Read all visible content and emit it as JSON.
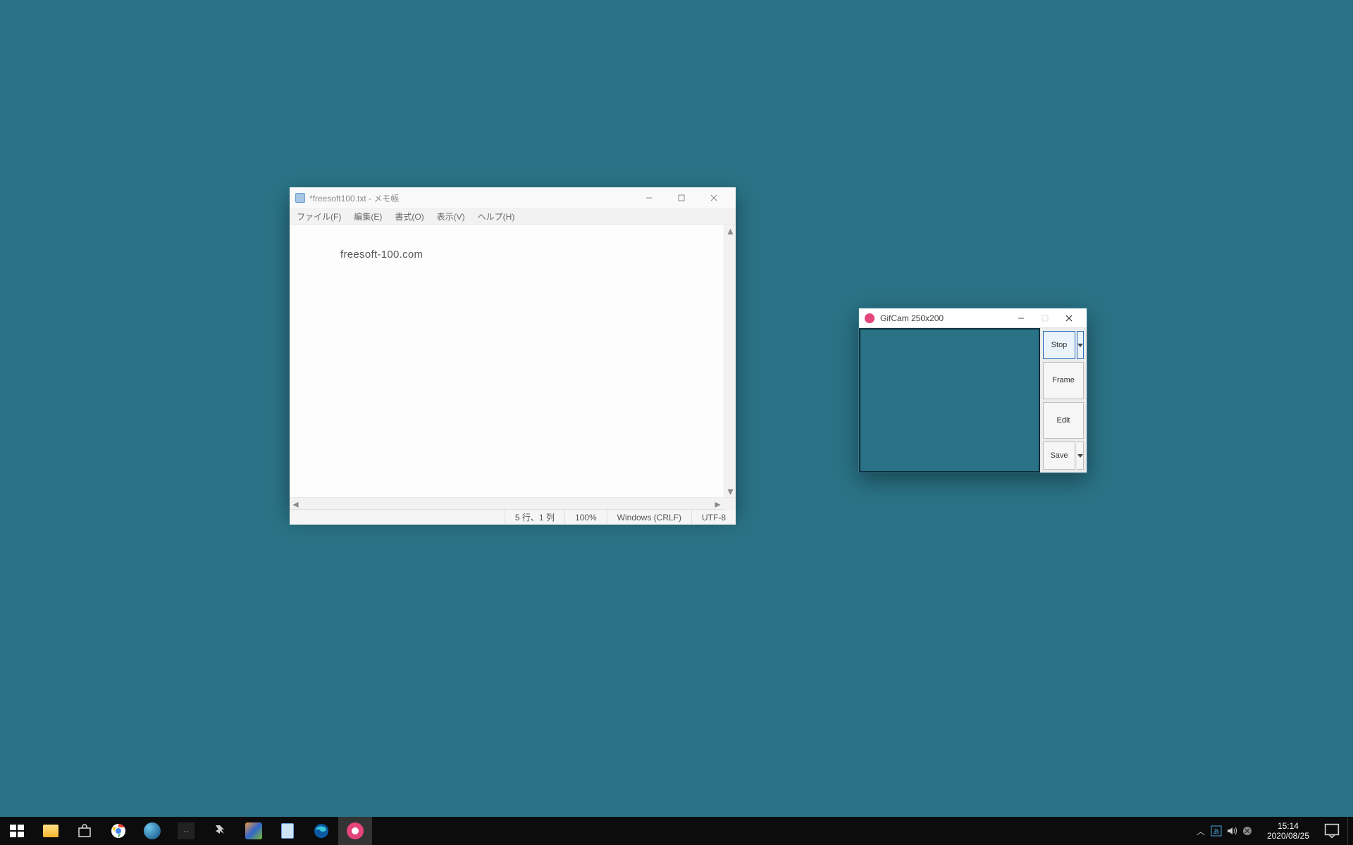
{
  "notepad": {
    "title": "*freesoft100.txt - メモ帳",
    "menu": {
      "file": "ファイル(F)",
      "edit": "編集(E)",
      "format": "書式(O)",
      "view": "表示(V)",
      "help": "ヘルプ(H)"
    },
    "content": "freesoft-100.com",
    "status": {
      "pos": "5 行、1 列",
      "zoom": "100%",
      "eol": "Windows (CRLF)",
      "enc": "UTF-8"
    }
  },
  "gifcam": {
    "title": "GifCam 250x200",
    "buttons": {
      "record": "Stop",
      "frame": "Frame",
      "edit": "Edit",
      "save": "Save"
    }
  },
  "taskbar": {
    "time": "15:14",
    "date": "2020/08/25"
  }
}
